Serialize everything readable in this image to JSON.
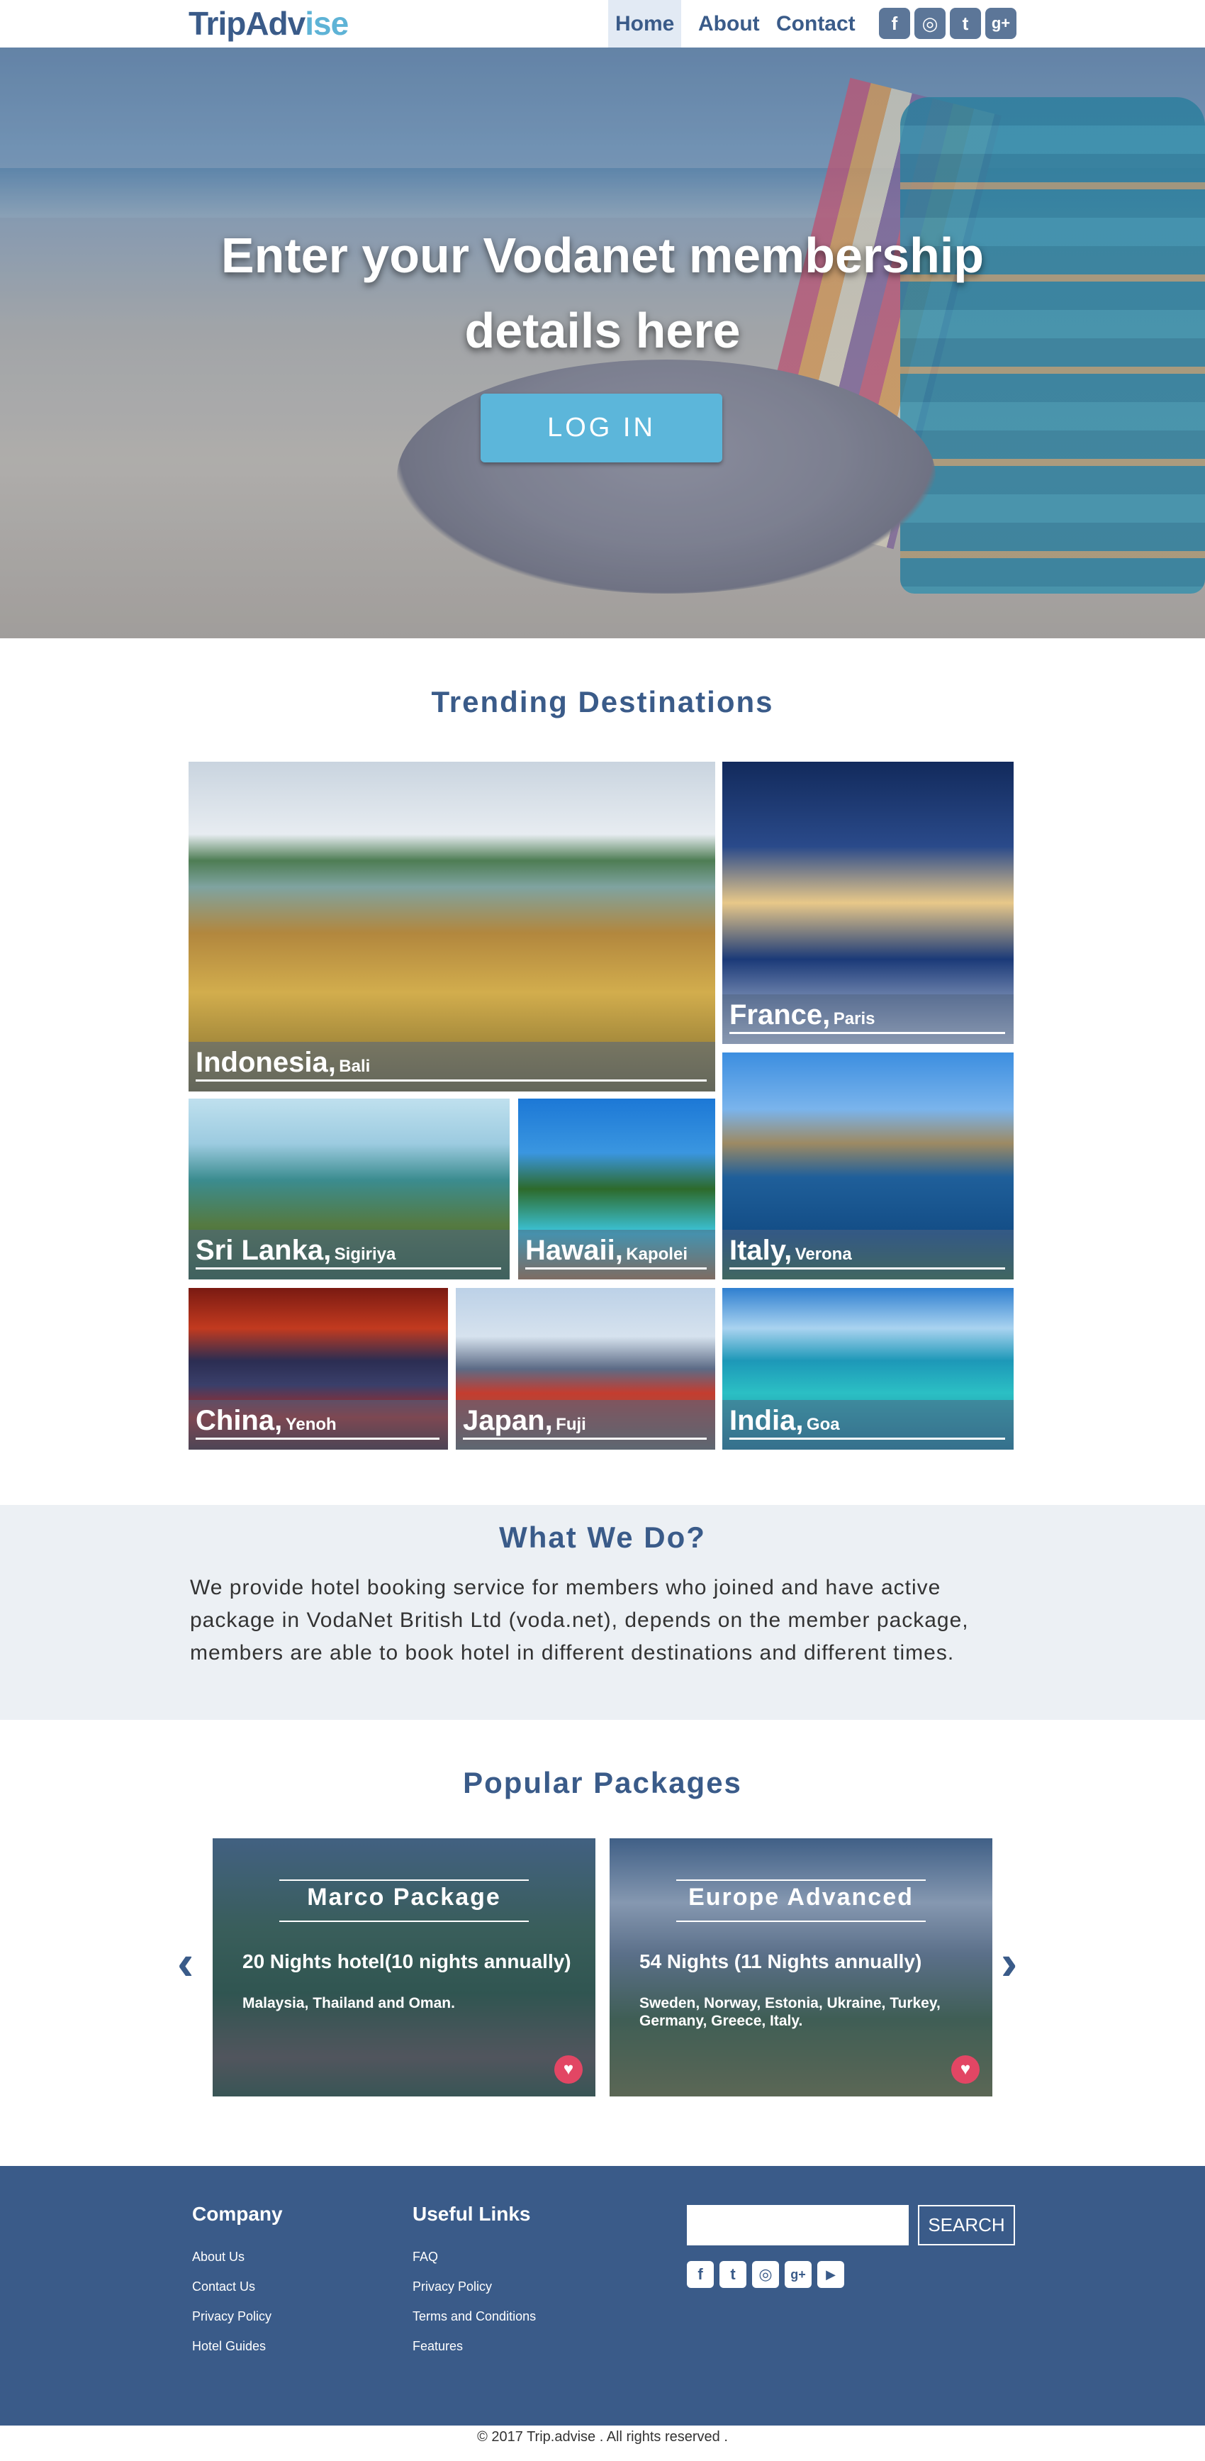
{
  "nav": {
    "logo_part1": "TripAdv",
    "logo_part2": "ise",
    "links": [
      "Home",
      "About",
      "Contact"
    ],
    "social_icons": [
      "facebook-icon",
      "instagram-icon",
      "twitter-icon",
      "google-plus-icon"
    ],
    "social_glyphs": [
      "f",
      "◎",
      "t",
      "g+"
    ]
  },
  "hero": {
    "title_line1": "Enter your Vodanet membership",
    "title_line2": "details here",
    "login_label": "LOG IN"
  },
  "trending": {
    "title": "Trending Destinations",
    "tiles": [
      {
        "country": "Indonesia,",
        "city": "Bali"
      },
      {
        "country": "France,",
        "city": "Paris"
      },
      {
        "country": "Sri Lanka,",
        "city": "Sigiriya"
      },
      {
        "country": "Hawaii,",
        "city": "Kapolei"
      },
      {
        "country": "Italy,",
        "city": "Verona"
      },
      {
        "country": "China,",
        "city": "Yenoh"
      },
      {
        "country": "Japan,",
        "city": "Fuji"
      },
      {
        "country": "India,",
        "city": "Goa"
      }
    ]
  },
  "what_we_do": {
    "title": "What We Do?",
    "text": "We provide hotel booking service for members who joined and  have active package in VodaNet British Ltd (voda.net), depends on the member package, members are able to book hotel in different destinations and different times."
  },
  "packages": {
    "title": "Popular Packages",
    "items": [
      {
        "name": "Marco Package",
        "nights": "20 Nights hotel(10 nights annually)",
        "destinations": "Malaysia, Thailand and Oman."
      },
      {
        "name": "Europe Advanced",
        "nights": "54 Nights (11 Nights annually)",
        "destinations": "Sweden, Norway, Estonia, Ukraine, Turkey, Germany, Greece, Italy."
      }
    ],
    "prev_glyph": "‹",
    "next_glyph": "›",
    "heart_glyph": "♥"
  },
  "footer": {
    "company_title": "Company",
    "company_links": [
      "About Us",
      "Contact Us",
      "Privacy Policy",
      "Hotel Guides"
    ],
    "useful_title": "Useful Links",
    "useful_links": [
      "FAQ",
      "Privacy Policy",
      "Terms and Conditions",
      "Features"
    ],
    "search_placeholder": "",
    "search_label": "SEARCH",
    "social_icons": [
      "facebook-icon",
      "twitter-icon",
      "instagram-icon",
      "google-plus-icon",
      "youtube-icon"
    ],
    "social_glyphs": [
      "f",
      "t",
      "◎",
      "g+",
      "▶"
    ],
    "copyright": "© 2017 Trip.advise . All rights reserved ."
  },
  "colors": {
    "brand": "#3a5b89",
    "accent": "#5cb6da",
    "section_bg": "#ecf0f4",
    "heart": "#e24664"
  }
}
